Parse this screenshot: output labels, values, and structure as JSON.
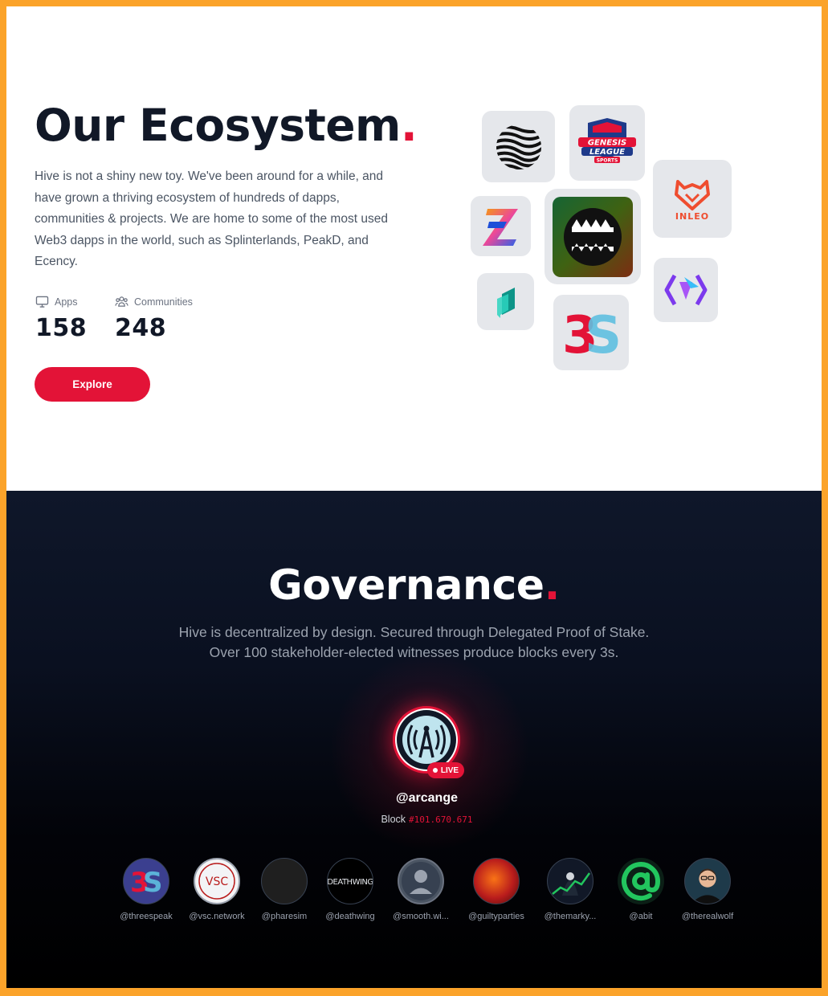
{
  "ecosystem": {
    "title": "Our Ecosystem",
    "title_dot": ".",
    "description": "Hive is not a shiny new toy. We've been around for a while, and have grown a thriving ecosystem of hundreds of dapps, communities & projects. We are home to some of the most used Web3 dapps in the world, such as Splinterlands, PeakD, and Ecency.",
    "stats": [
      {
        "label": "Apps",
        "value": "158",
        "icon": "monitor-icon"
      },
      {
        "label": "Communities",
        "value": "248",
        "icon": "users-icon"
      }
    ],
    "explore_label": "Explore",
    "app_tiles": [
      "waves-logo",
      "genesis-league-sports-logo",
      "inleo-logo",
      "z-logo",
      "monster-game-logo",
      "leo-logo",
      "peakd-logo",
      "3speak-logo"
    ],
    "genesis_text": [
      "GENESIS",
      "LEAGUE",
      "SPORTS"
    ],
    "inleo_text": "INLEO"
  },
  "governance": {
    "title": "Governance",
    "title_dot": ".",
    "description_line1": "Hive is decentralized by design. Secured through Delegated Proof of Stake.",
    "description_line2": "Over 100 stakeholder-elected witnesses produce blocks every 3s.",
    "live_witness": {
      "name": "@arcange",
      "badge": "LIVE",
      "block_label": "Block",
      "block_number": "#101.670.671"
    },
    "witnesses": [
      {
        "name": "@threespeak"
      },
      {
        "name": "@vsc.network",
        "avatar_text": "VSC"
      },
      {
        "name": "@pharesim"
      },
      {
        "name": "@deathwing",
        "avatar_text": "DEATHWING"
      },
      {
        "name": "@smooth.wi..."
      },
      {
        "name": "@guiltyparties"
      },
      {
        "name": "@themarky..."
      },
      {
        "name": "@abit"
      },
      {
        "name": "@therealwolf"
      }
    ]
  },
  "colors": {
    "accent": "#e31337",
    "frame": "#fba32a",
    "dark_bg": "#0f172a"
  }
}
